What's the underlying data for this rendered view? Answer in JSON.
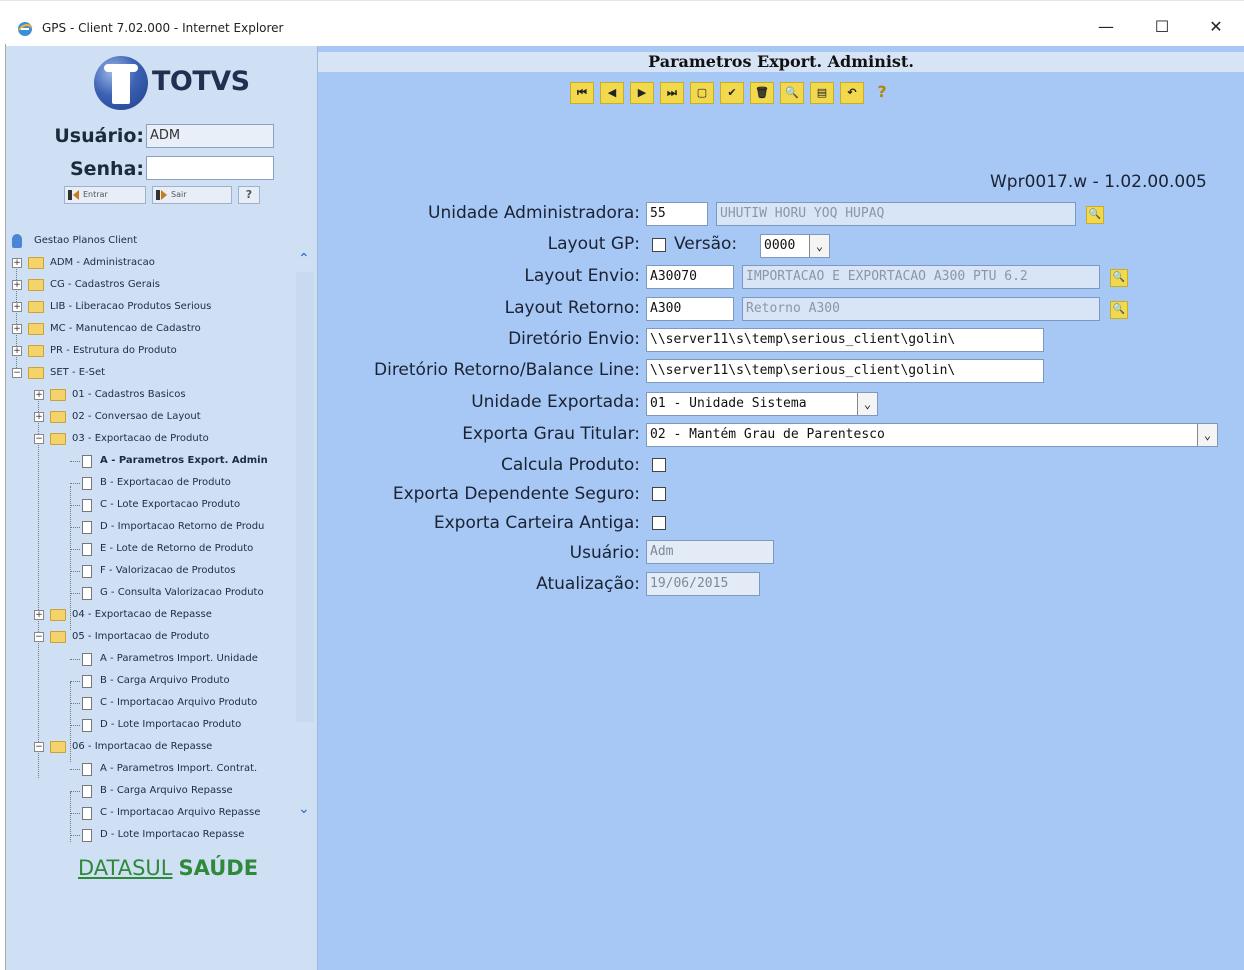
{
  "window": {
    "title": "GPS - Client 7.02.000 - Internet Explorer",
    "min": "—",
    "max": "☐",
    "close": "✕"
  },
  "sidebar": {
    "brand": "TOTVS",
    "user_label": "Usuário:",
    "user_value": "ADM",
    "pass_label": "Senha:",
    "pass_value": "",
    "enter_label": "Entrar",
    "exit_label": "Sair",
    "help_label": "?",
    "tree": [
      "Gestao Planos Client",
      "ADM - Administracao",
      "CG - Cadastros Gerais",
      "LIB - Liberacao Produtos Serious",
      "MC - Manutencao de Cadastro",
      "PR - Estrutura do Produto",
      "SET - E-Set",
      "01 - Cadastros Basicos",
      "02 - Conversao de Layout",
      "03 - Exportacao de Produto",
      "A - Parametros Export. Admin",
      "B - Exportacao de Produto",
      "C - Lote Exportacao Produto",
      "D - Importacao Retorno de Produ",
      "E - Lote de Retorno de Produto",
      "F - Valorizacao de Produtos",
      "G - Consulta Valorizacao Produto",
      "04 - Exportacao de Repasse",
      "05 - Importacao de Produto",
      "A - Parametros Import. Unidade",
      "B - Carga Arquivo Produto",
      "C - Importacao Arquivo Produto",
      "D - Lote Importacao Produto",
      "06 - Importacao de Repasse",
      "A - Parametros Import. Contrat.",
      "B - Carga Arquivo Repasse",
      "C - Importacao Arquivo Repasse",
      "D - Lote Importacao Repasse"
    ],
    "footer_brand_1": "DATASUL",
    "footer_brand_2": "SAÚDE"
  },
  "main": {
    "title": "Parametros Export. Administ.",
    "toolbar": [
      "⏮",
      "◀",
      "▶",
      "⏭",
      "▢",
      "✔",
      "🗑",
      "🔍",
      "▤",
      "↶",
      "?"
    ],
    "version": "Wpr0017.w - 1.02.00.005",
    "fields": {
      "unidade_adm_label": "Unidade Administradora:",
      "unidade_adm_code": "55",
      "unidade_adm_name": "UHUTIW HORU YOQ HUPAQ",
      "layout_gp_label": "Layout GP:",
      "versao_label": "Versão:",
      "versao_value": "0000",
      "layout_envio_label": "Layout Envio:",
      "layout_envio_code": "A30070",
      "layout_envio_desc": "IMPORTACAO E EXPORTACAO A300 PTU 6.2",
      "layout_retorno_label": "Layout Retorno:",
      "layout_retorno_code": "A300",
      "layout_retorno_desc": "Retorno A300",
      "dir_envio_label": "Diretório Envio:",
      "dir_envio_value": "\\\\server11\\s\\temp\\serious_client\\golin\\",
      "dir_retorno_label": "Diretório Retorno/Balance Line:",
      "dir_retorno_value": "\\\\server11\\s\\temp\\serious_client\\golin\\",
      "unidade_exp_label": "Unidade Exportada:",
      "unidade_exp_value": "01 - Unidade Sistema",
      "grau_label": "Exporta Grau Titular:",
      "grau_value": "02 - Mantém Grau de Parentesco",
      "calcula_label": "Calcula Produto:",
      "dependente_label": "Exporta Dependente Seguro:",
      "carteira_label": "Exporta Carteira Antiga:",
      "usuario_label": "Usuário:",
      "usuario_value": "Adm",
      "atualizacao_label": "Atualização:",
      "atualizacao_value": "19/06/2015"
    }
  }
}
